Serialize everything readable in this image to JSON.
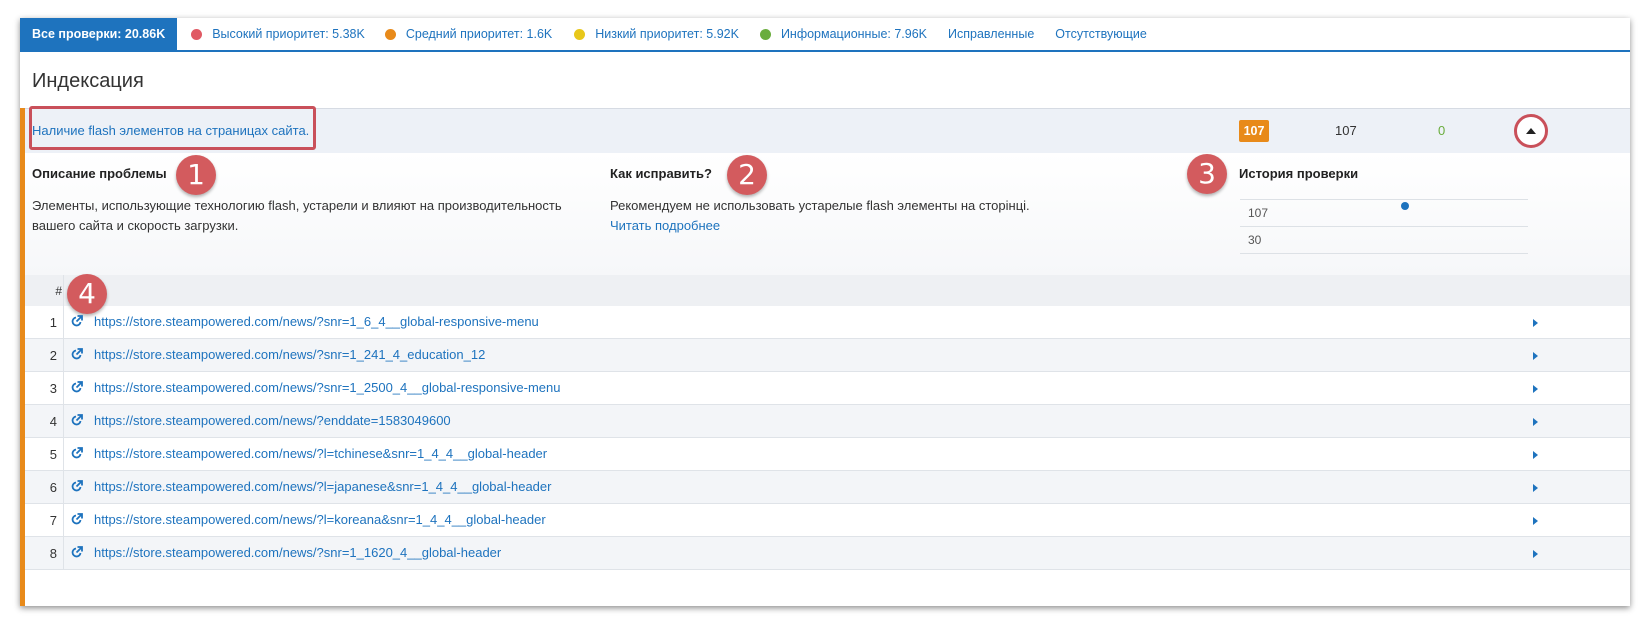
{
  "filters": {
    "all": "Все проверки: 20.86K",
    "items": [
      {
        "label": "Высокий приоритет: 5.38K",
        "color": "#e05a64"
      },
      {
        "label": "Средний приоритет: 1.6K",
        "color": "#e88a1a"
      },
      {
        "label": "Низкий приоритет: 5.92K",
        "color": "#e8c71a"
      },
      {
        "label": "Информационные: 7.96K",
        "color": "#6aad3d"
      }
    ],
    "fixed": "Исправленные",
    "missing": "Отсутствующие"
  },
  "section": {
    "title": "Индексация"
  },
  "issue": {
    "title": "Наличие flash элементов на страницах сайта.",
    "badge": "107",
    "total": "107",
    "fixed": "0",
    "description_heading": "Описание проблемы",
    "description_text": "Элементы, использующие технологию flash, устарели и влияют на производительность вашего сайта и скорость загрузки.",
    "fix_heading": "Как исправить?",
    "fix_text": "Рекомендуем не использовать устарелые flash элементы на сторінці.",
    "fix_link": "Читать подробнее",
    "history_heading": "История проверки",
    "history_top": "107",
    "history_bottom": "30"
  },
  "markers": [
    "1",
    "2",
    "3",
    "4"
  ],
  "table": {
    "header": "#",
    "rows": [
      {
        "num": "1",
        "url": "https://store.steampowered.com/news/?snr=1_6_4__global-responsive-menu"
      },
      {
        "num": "2",
        "url": "https://store.steampowered.com/news/?snr=1_241_4_education_12"
      },
      {
        "num": "3",
        "url": "https://store.steampowered.com/news/?snr=1_2500_4__global-responsive-menu"
      },
      {
        "num": "4",
        "url": "https://store.steampowered.com/news/?enddate=1583049600"
      },
      {
        "num": "5",
        "url": "https://store.steampowered.com/news/?l=tchinese&snr=1_4_4__global-header"
      },
      {
        "num": "6",
        "url": "https://store.steampowered.com/news/?l=japanese&snr=1_4_4__global-header"
      },
      {
        "num": "7",
        "url": "https://store.steampowered.com/news/?l=koreana&snr=1_4_4__global-header"
      },
      {
        "num": "8",
        "url": "https://store.steampowered.com/news/?snr=1_1620_4__global-header"
      }
    ]
  }
}
